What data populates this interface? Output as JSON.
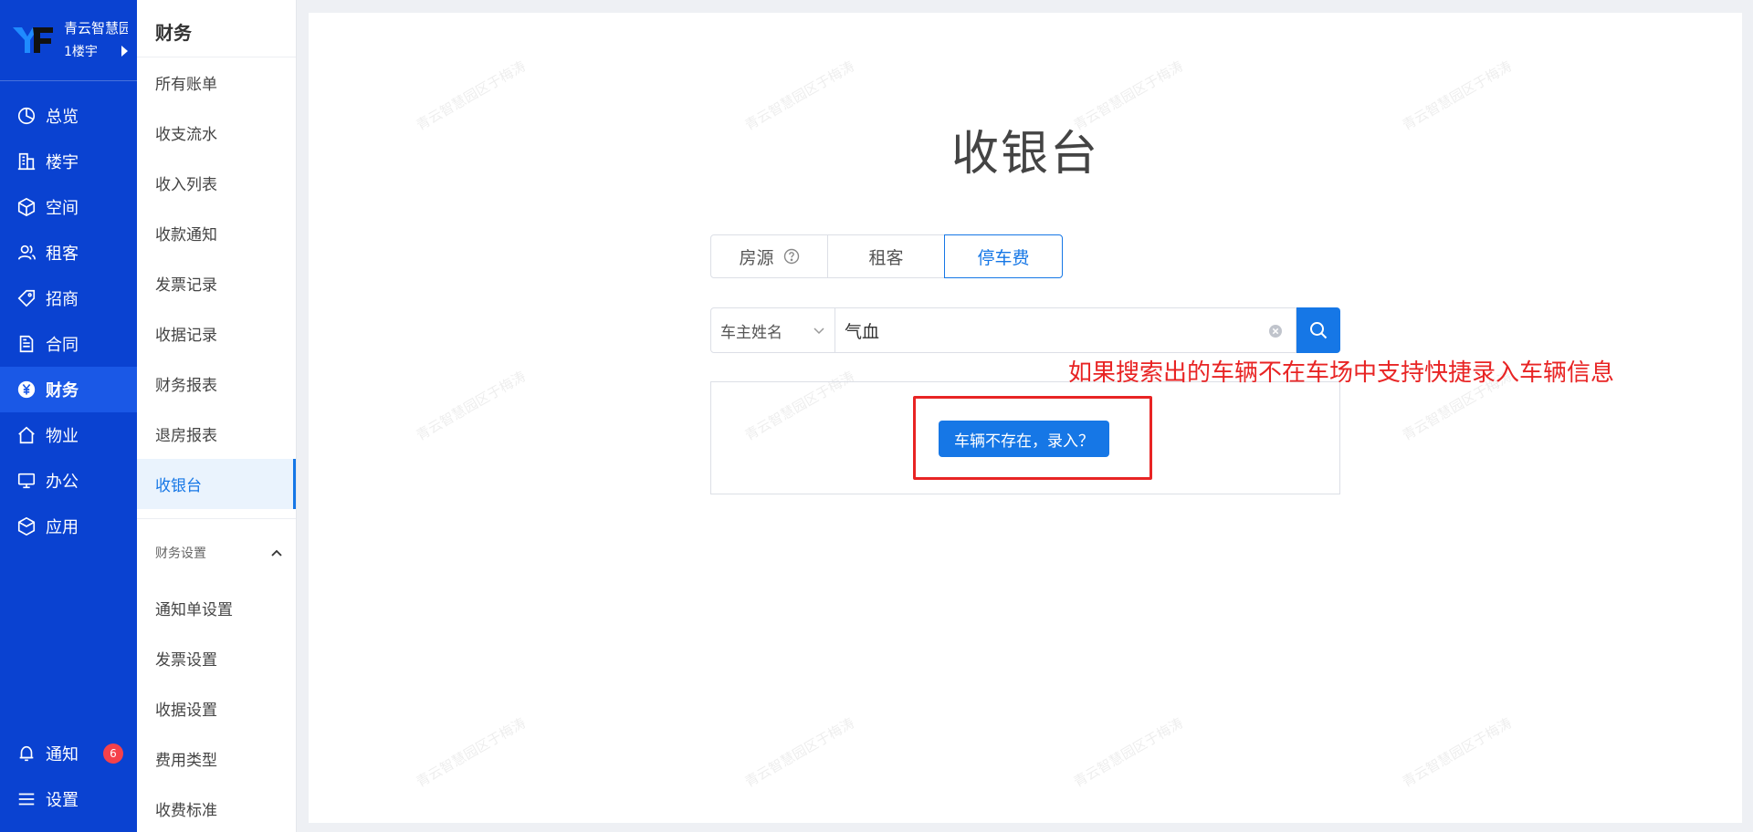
{
  "brand": {
    "name": "青云智慧园区",
    "sub": "1楼宇"
  },
  "nav": {
    "items": [
      {
        "label": "总览",
        "icon": "pie-chart-icon"
      },
      {
        "label": "楼宇",
        "icon": "building-icon"
      },
      {
        "label": "空间",
        "icon": "cube-icon"
      },
      {
        "label": "租客",
        "icon": "users-icon"
      },
      {
        "label": "招商",
        "icon": "tag-icon"
      },
      {
        "label": "合同",
        "icon": "document-icon"
      },
      {
        "label": "财务",
        "icon": "yen-icon",
        "active": true
      },
      {
        "label": "物业",
        "icon": "home-icon"
      },
      {
        "label": "办公",
        "icon": "monitor-icon"
      },
      {
        "label": "应用",
        "icon": "app-cube-icon"
      }
    ],
    "notify_label": "通知",
    "notify_badge": "6",
    "settings_label": "设置"
  },
  "submenu": {
    "title": "财务",
    "items": [
      "所有账单",
      "收支流水",
      "收入列表",
      "收款通知",
      "发票记录",
      "收据记录",
      "财务报表",
      "退房报表",
      "收银台"
    ],
    "active": "收银台",
    "group_label": "财务设置",
    "group_items": [
      "通知单设置",
      "发票设置",
      "收据设置",
      "费用类型",
      "收费标准"
    ]
  },
  "main": {
    "title": "收银台",
    "tabs": [
      "房源",
      "租客",
      "停车费"
    ],
    "active_tab": "停车费",
    "search": {
      "select_value": "车主姓名",
      "input_value": "气血"
    },
    "annotation": "如果搜索出的车辆不在车场中支持快捷录入车辆信息",
    "enter_button": "车辆不存在，录入？",
    "watermark": "青云智慧园区于梅涛"
  },
  "colors": {
    "nav_bg": "#0a42d1",
    "accent": "#1677e6",
    "annotation": "#e82424",
    "badge": "#f5414a"
  }
}
